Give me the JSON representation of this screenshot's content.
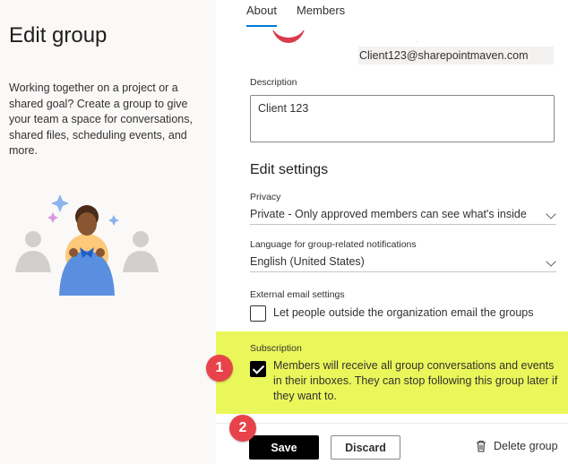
{
  "left": {
    "title": "Edit group",
    "description": "Working together on a project or a shared goal? Create a group to give your team a space for conversations, shared files, scheduling events, and more."
  },
  "tabs": [
    {
      "label": "About",
      "active": true
    },
    {
      "label": "Members",
      "active": false
    }
  ],
  "email": "Client123@sharepointmaven.com",
  "description_field": {
    "label": "Description",
    "value": "Client 123"
  },
  "edit_settings": {
    "heading": "Edit settings",
    "privacy": {
      "label": "Privacy",
      "value": "Private - Only approved members can see what's inside"
    },
    "language": {
      "label": "Language for group-related notifications",
      "value": "English (United States)"
    },
    "external_email": {
      "label": "External email settings",
      "checkbox_label": "Let people outside the organization email the groups",
      "checked": false
    },
    "subscription": {
      "label": "Subscription",
      "checkbox_label": "Members will receive all group conversations and events in their inboxes. They can stop following this group later if they want to.",
      "checked": true
    }
  },
  "footer": {
    "save_label": "Save",
    "discard_label": "Discard",
    "delete_label": "Delete group"
  },
  "annotations": {
    "badge1": "1",
    "badge2": "2"
  },
  "colors": {
    "highlight": "#eaf75a",
    "badge": "#e8434a",
    "accent": "#0078d4"
  }
}
